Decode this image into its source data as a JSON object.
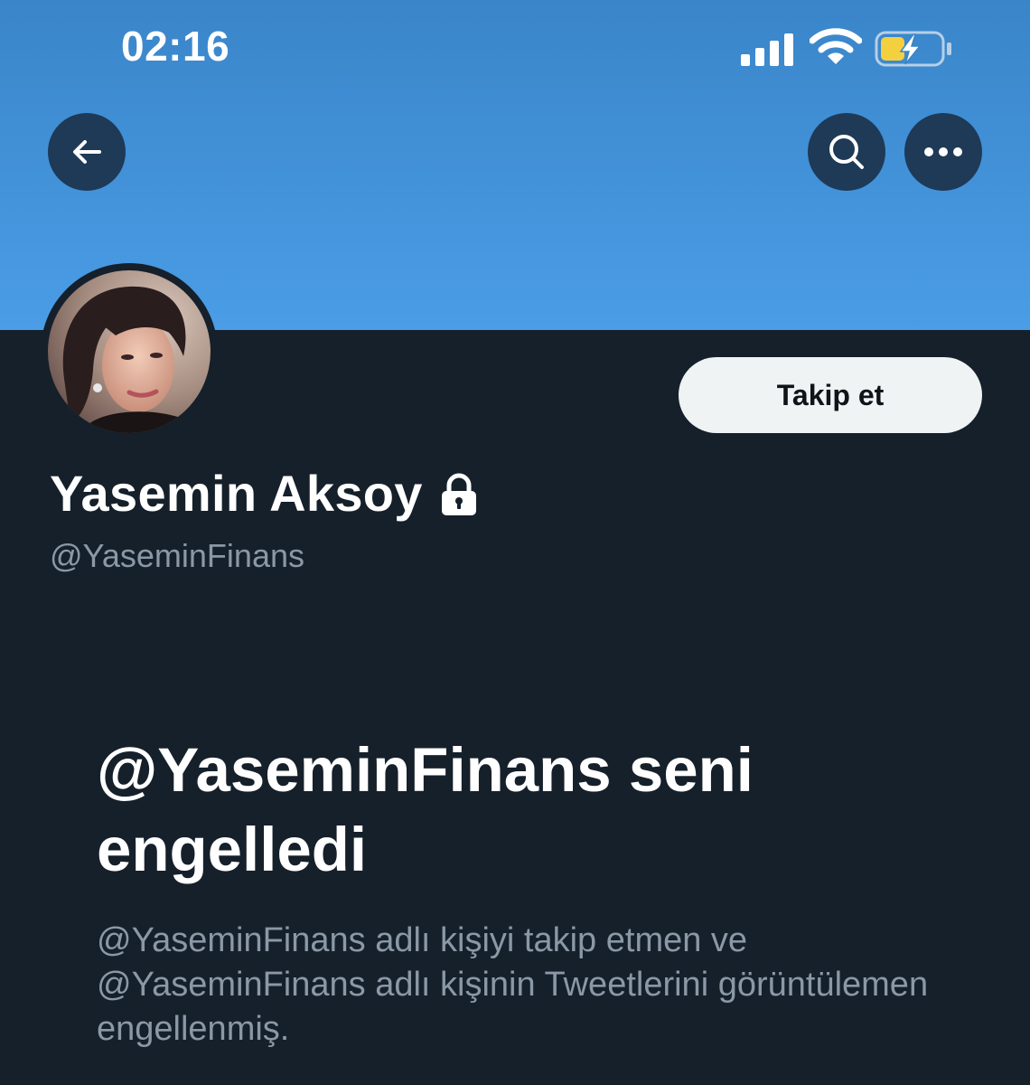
{
  "status_bar": {
    "time": "02:16",
    "signal_icon": "cellular-signal-icon",
    "wifi_icon": "wifi-icon",
    "battery_icon": "battery-charging-icon",
    "battery_color": "#f4d03f"
  },
  "header": {
    "back_icon": "arrow-left-icon",
    "search_icon": "search-icon",
    "more_icon": "more-horizontal-icon",
    "banner_color": "#4a9de6"
  },
  "profile": {
    "display_name": "Yasemin Aksoy",
    "handle": "@YaseminFinans",
    "protected_icon": "lock-icon",
    "follow_label": "Takip et"
  },
  "blocked": {
    "title": "@YaseminFinans seni engelledi",
    "description": "@YaseminFinans adlı kişiyi takip etmen ve @YaseminFinans adlı kişinin Tweetlerini görüntülemen engellenmiş."
  },
  "colors": {
    "background": "#15202b",
    "text_primary": "#ffffff",
    "text_secondary": "#8b98a5",
    "button_bg": "#eff3f4"
  }
}
